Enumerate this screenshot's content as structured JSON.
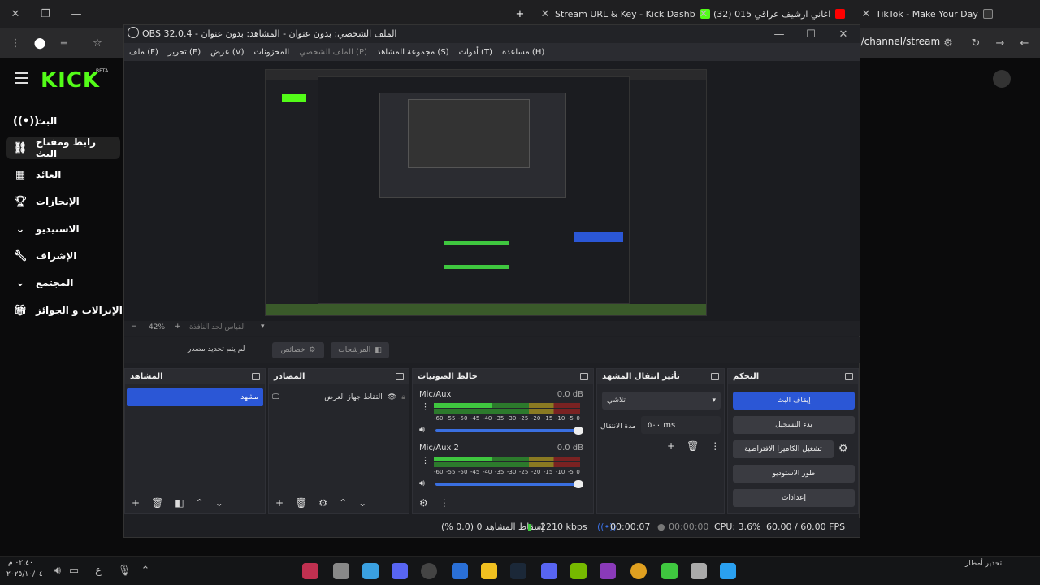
{
  "browser": {
    "tabs": [
      {
        "label": "Stream URL & Key - Kick Dashb",
        "color": "#53fc18"
      },
      {
        "label": "(32) اغاني ارشيف عراقي 015",
        "color": "#ff0000"
      },
      {
        "label": "TikTok - Make Your Day",
        "color": "#111111"
      }
    ],
    "url": "n/channel/stream"
  },
  "kick": {
    "logo": "KICK",
    "beta": "BETA",
    "nav": [
      {
        "label": "البث",
        "icon": "broadcast-icon"
      },
      {
        "label": "رابط ومفتاح البث",
        "icon": "link-icon"
      },
      {
        "label": "العائد",
        "icon": "chart-icon"
      },
      {
        "label": "الإنجازات",
        "icon": "trophy-icon"
      },
      {
        "label": "الاستيديو",
        "icon": "chevron-down-icon"
      },
      {
        "label": "الإشراف",
        "icon": "wrench-icon"
      },
      {
        "label": "المجتمع",
        "icon": "chevron-down-icon"
      },
      {
        "label": "الإنزالات و الجوائز",
        "icon": "gift-icon"
      }
    ]
  },
  "obs": {
    "title": "الملف الشخصي: بدون عنوان - المشاهد: بدون عنوان - OBS 32.0.4",
    "menu": [
      "ملف (F)",
      "تحرير (E)",
      "عرض (V)",
      "المخزونات",
      "الملف الشخصي (P)",
      "مجموعة المشاهد (S)",
      "أدوات (T)",
      "مساعدة (H)"
    ],
    "zoom": "42%",
    "zoom_label": "القياس لحد النافذة",
    "no_source": "لم يتم تحديد مصدر",
    "props_btn": "خصائص",
    "filters_btn": "المرشحات",
    "docks": {
      "scenes": {
        "title": "المشاهد",
        "items": [
          "مشهد"
        ]
      },
      "sources": {
        "title": "المصادر",
        "items": [
          "التقاط جهاز العرض"
        ]
      },
      "mixer": {
        "title": "خالط الصوتيات",
        "channels": [
          {
            "name": "Mic/Aux",
            "db": "0.0 dB"
          },
          {
            "name": "Mic/Aux 2",
            "db": "0.0 dB"
          }
        ],
        "ticks": [
          "-60",
          "-55",
          "-50",
          "-45",
          "-40",
          "-35",
          "-30",
          "-25",
          "-20",
          "-15",
          "-10",
          "-5",
          "0"
        ]
      },
      "transitions": {
        "title": "تأثير انتقال المشهد",
        "type": "تلاشي",
        "duration_label": "مدة الانتقال",
        "duration": "٥٠٠ ms"
      },
      "controls": {
        "title": "التحكم",
        "buttons": [
          "إيقاف البث",
          "بدء التسجيل",
          "تشغيل الكاميرا الافتراضية",
          "طور الاستوديو",
          "إعدادات"
        ]
      }
    },
    "status": {
      "dropped": "إسقاط المشاهد 0 (0.0 %)",
      "kbps": "2210 kbps",
      "stream_time": "00:00:07",
      "rec_time": "00:00:00",
      "cpu": "CPU: 3.6%",
      "fps": "60.00 / 60.00 FPS"
    }
  },
  "taskbar": {
    "time": "٠٢:٤٠ م",
    "date": "٢٠٢٥/١٠/٠٤",
    "weather": "تحذير أمطار"
  }
}
